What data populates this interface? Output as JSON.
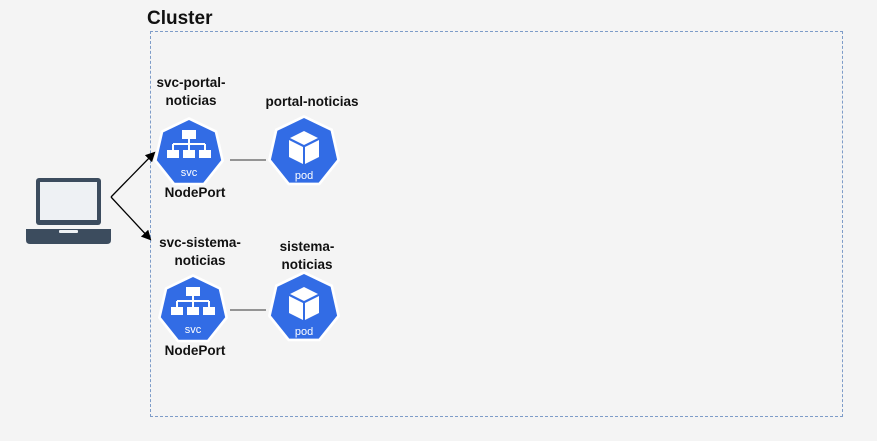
{
  "cluster": {
    "title": "Cluster"
  },
  "services": [
    {
      "name_line1": "svc-portal-",
      "name_line2": "noticias",
      "icon_label": "svc",
      "type": "NodePort"
    },
    {
      "name_line1": "svc-sistema-",
      "name_line2": "noticias",
      "icon_label": "svc",
      "type": "NodePort"
    }
  ],
  "pods": [
    {
      "name_line1": "portal-noticias",
      "name_line2": "",
      "icon_label": "pod"
    },
    {
      "name_line1": "sistema-",
      "name_line2": "noticias",
      "icon_label": "pod"
    }
  ],
  "client": {
    "icon": "laptop-icon"
  },
  "colors": {
    "k8s_blue": "#326ce5",
    "cluster_border": "#7e9cc8",
    "laptop": "#3c4c5e",
    "screen": "#eef1f4"
  }
}
